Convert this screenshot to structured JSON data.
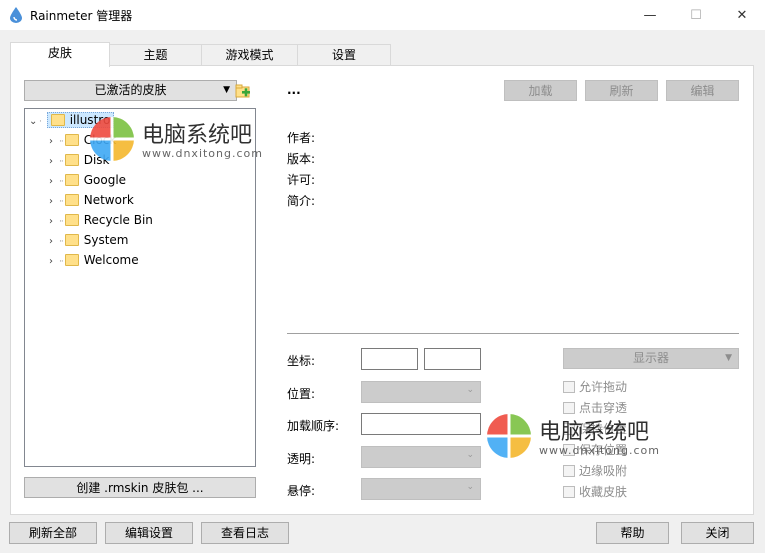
{
  "window": {
    "title": "Rainmeter 管理器",
    "minimize_glyph": "—",
    "maximize_glyph": "☐",
    "close_glyph": "✕"
  },
  "tabs": [
    {
      "label": "皮肤",
      "active": true
    },
    {
      "label": "主题",
      "active": false
    },
    {
      "label": "游戏模式",
      "active": false
    },
    {
      "label": "设置",
      "active": false
    }
  ],
  "skins": {
    "active_dropdown": "已激活的皮肤",
    "add_icon": "add-folder-icon",
    "tree": {
      "root": "illustro",
      "children": [
        "Clock",
        "Disk",
        "Google",
        "Network",
        "Recycle Bin",
        "System",
        "Welcome"
      ]
    },
    "create_button": "创建 .rmskin 皮肤包 ..."
  },
  "details": {
    "name": "...",
    "load_button": "加载",
    "refresh_button": "刷新",
    "edit_button": "编辑",
    "author_label": "作者:",
    "version_label": "版本:",
    "license_label": "许可:",
    "description_label": "简介:"
  },
  "settings": {
    "coords_label": "坐标:",
    "position_label": "位置:",
    "load_order_label": "加载顺序:",
    "transparency_label": "透明:",
    "on_hover_label": "悬停:",
    "display_dropdown": "显示器",
    "checkboxes": [
      "允许拖动",
      "点击穿透",
      "保持位置",
      "保存位置",
      "边缘吸附",
      "收藏皮肤"
    ]
  },
  "footer": {
    "refresh_all": "刷新全部",
    "edit_settings": "编辑设置",
    "view_log": "查看日志",
    "help": "帮助",
    "close": "关闭"
  },
  "watermark": {
    "brand": "电脑系统吧",
    "url": "www.dnxitong.com"
  },
  "colors": {
    "window_bg": "#f0f0f0",
    "panel_bg": "#ffffff",
    "tree_selected": "#cce8ff",
    "disabled_fill": "#cccccc",
    "folder": "#ffe08a"
  }
}
